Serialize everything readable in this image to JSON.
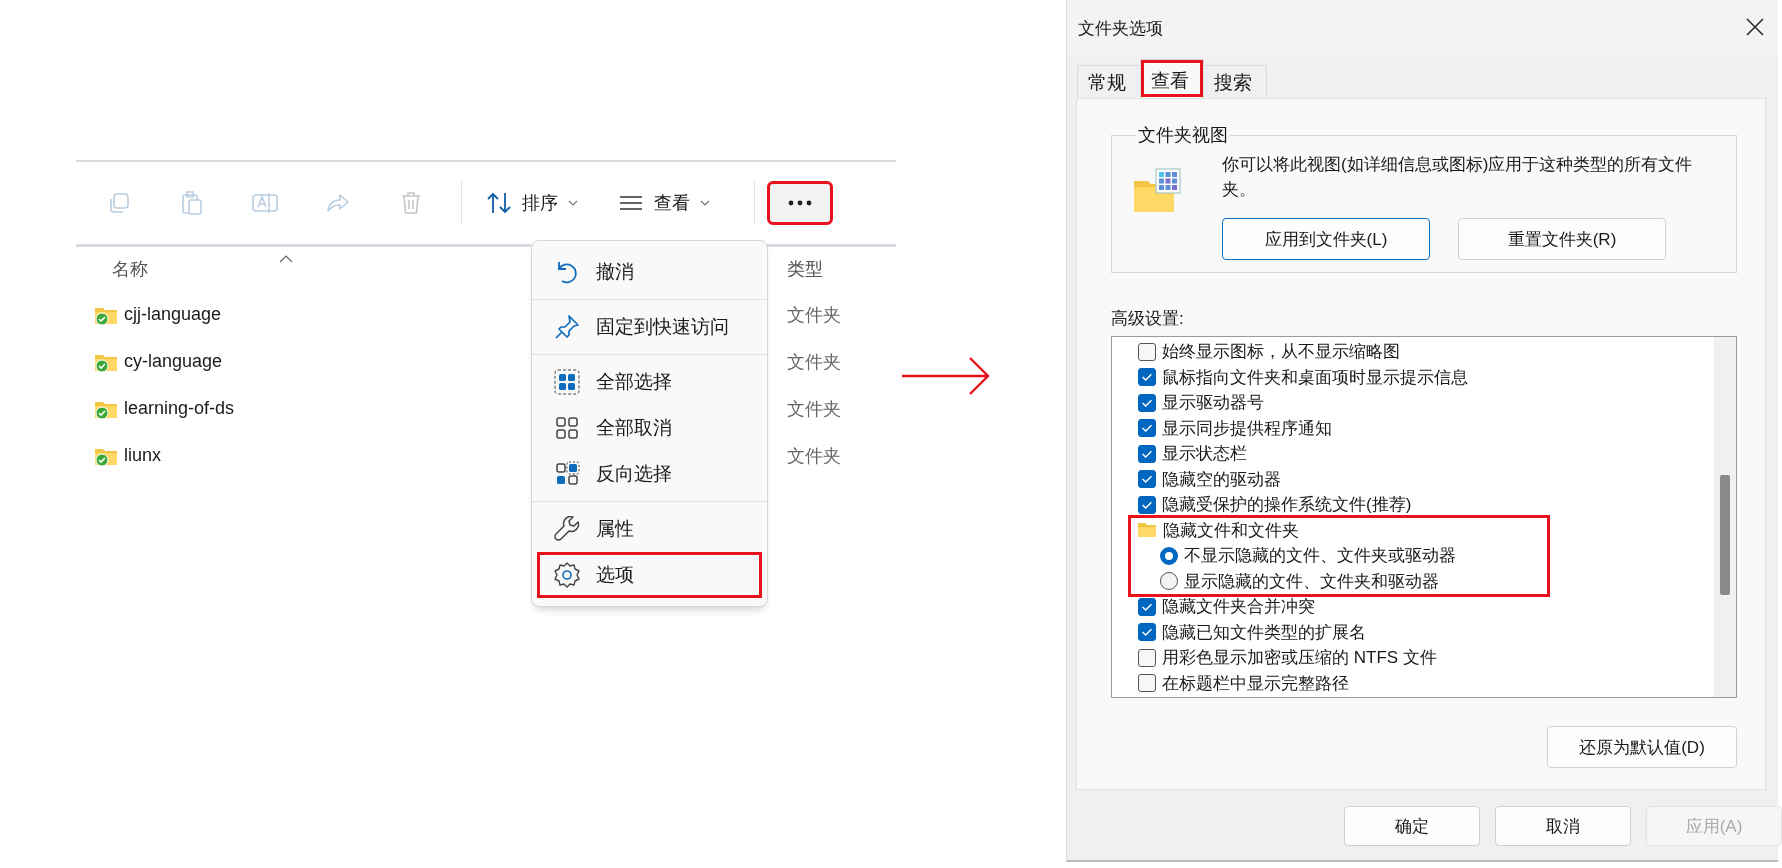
{
  "explorer": {
    "toolbar": [
      {
        "label": "排序"
      },
      {
        "label": "查看"
      }
    ],
    "more_button": {
      "highlighted": true
    },
    "columns": [
      "名称",
      "类型"
    ],
    "rows": [
      {
        "name": "cjj-language",
        "type": "文件夹"
      },
      {
        "name": "cy-language",
        "type": "文件夹"
      },
      {
        "name": "learning-of-ds",
        "type": "文件夹"
      },
      {
        "name": "liunx",
        "type": "文件夹"
      }
    ],
    "menu": {
      "groups": [
        [
          {
            "label": "撤消",
            "highlighted": false
          }
        ],
        [
          {
            "label": "固定到快速访问",
            "highlighted": false
          }
        ],
        [
          {
            "label": "全部选择",
            "highlighted": false
          },
          {
            "label": "全部取消",
            "highlighted": false
          },
          {
            "label": "反向选择",
            "highlighted": false
          }
        ],
        [
          {
            "label": "属性",
            "highlighted": false
          },
          {
            "label": "选项",
            "highlighted": true
          }
        ]
      ]
    }
  },
  "dialog": {
    "title": "文件夹选项",
    "tabs": [
      {
        "label": "常规",
        "selected": false,
        "highlighted": false
      },
      {
        "label": "查看",
        "selected": true,
        "highlighted": true
      },
      {
        "label": "搜索",
        "selected": false,
        "highlighted": false
      }
    ],
    "folder_views": {
      "legend": "文件夹视图",
      "description": "你可以将此视图(如详细信息或图标)应用于这种类型的所有文件夹。",
      "buttons": [
        {
          "label": "应用到文件夹(L)",
          "focused": true
        },
        {
          "label": "重置文件夹(R)",
          "focused": false
        }
      ]
    },
    "advanced_label": "高级设置:",
    "settings": [
      {
        "kind": "checkbox",
        "label": "始终显示图标，从不显示缩略图",
        "checked": false
      },
      {
        "kind": "checkbox",
        "label": "鼠标指向文件夹和桌面项时显示提示信息",
        "checked": true
      },
      {
        "kind": "checkbox",
        "label": "显示驱动器号",
        "checked": true
      },
      {
        "kind": "checkbox",
        "label": "显示同步提供程序通知",
        "checked": true
      },
      {
        "kind": "checkbox",
        "label": "显示状态栏",
        "checked": true
      },
      {
        "kind": "checkbox",
        "label": "隐藏空的驱动器",
        "checked": true
      },
      {
        "kind": "checkbox",
        "label": "隐藏受保护的操作系统文件(推荐)",
        "checked": true
      },
      {
        "kind": "folder",
        "label": "隐藏文件和文件夹",
        "highlighted": true,
        "children": [
          {
            "kind": "radio",
            "label": "不显示隐藏的文件、文件夹或驱动器",
            "selected": true
          },
          {
            "kind": "radio",
            "label": "显示隐藏的文件、文件夹和驱动器",
            "selected": false
          }
        ]
      },
      {
        "kind": "checkbox",
        "label": "隐藏文件夹合并冲突",
        "checked": true
      },
      {
        "kind": "checkbox",
        "label": "隐藏已知文件类型的扩展名",
        "checked": true
      },
      {
        "kind": "checkbox",
        "label": "用彩色显示加密或压缩的 NTFS 文件",
        "checked": false
      },
      {
        "kind": "checkbox",
        "label": "在标题栏中显示完整路径",
        "checked": false
      }
    ],
    "restore_button": "还原为默认值(D)",
    "buttons": [
      {
        "label": "确定",
        "disabled": false
      },
      {
        "label": "取消",
        "disabled": false
      },
      {
        "label": "应用(A)",
        "disabled": true
      }
    ]
  }
}
